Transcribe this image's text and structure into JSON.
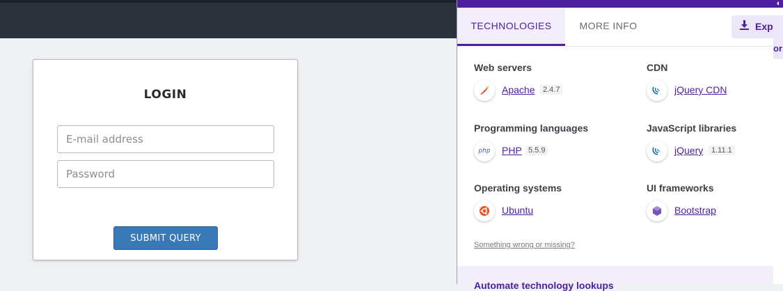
{
  "login": {
    "title": "LOGIN",
    "email_placeholder": "E-mail address",
    "password_placeholder": "Password",
    "submit_label": "SUBMIT QUERY"
  },
  "panel": {
    "tabs": [
      {
        "label": "TECHNOLOGIES",
        "active": true
      },
      {
        "label": "MORE INFO",
        "active": false
      }
    ],
    "export_label": "Exp",
    "side_label": "or",
    "categories": [
      {
        "title": "Web servers",
        "items": [
          {
            "name": "Apache",
            "version": "2.4.7",
            "icon": "apache-feather-icon"
          }
        ]
      },
      {
        "title": "CDN",
        "items": [
          {
            "name": "jQuery CDN",
            "version": "",
            "icon": "jquery-icon"
          }
        ]
      },
      {
        "title": "Programming languages",
        "items": [
          {
            "name": "PHP",
            "version": "5.5.9",
            "icon": "php-icon"
          }
        ]
      },
      {
        "title": "JavaScript libraries",
        "items": [
          {
            "name": "jQuery",
            "version": "1.11.1",
            "icon": "jquery-icon"
          }
        ]
      },
      {
        "title": "Operating systems",
        "items": [
          {
            "name": "Ubuntu",
            "version": "",
            "icon": "ubuntu-icon"
          }
        ]
      },
      {
        "title": "UI frameworks",
        "items": [
          {
            "name": "Bootstrap",
            "version": "",
            "icon": "bootstrap-icon"
          }
        ]
      }
    ],
    "wrong_link": "Something wrong or missing?",
    "bottom_text": "Automate technology lookups"
  },
  "colors": {
    "accent": "#4b1f9e",
    "topbar": "#2b323b",
    "submit": "#3a79b8"
  }
}
